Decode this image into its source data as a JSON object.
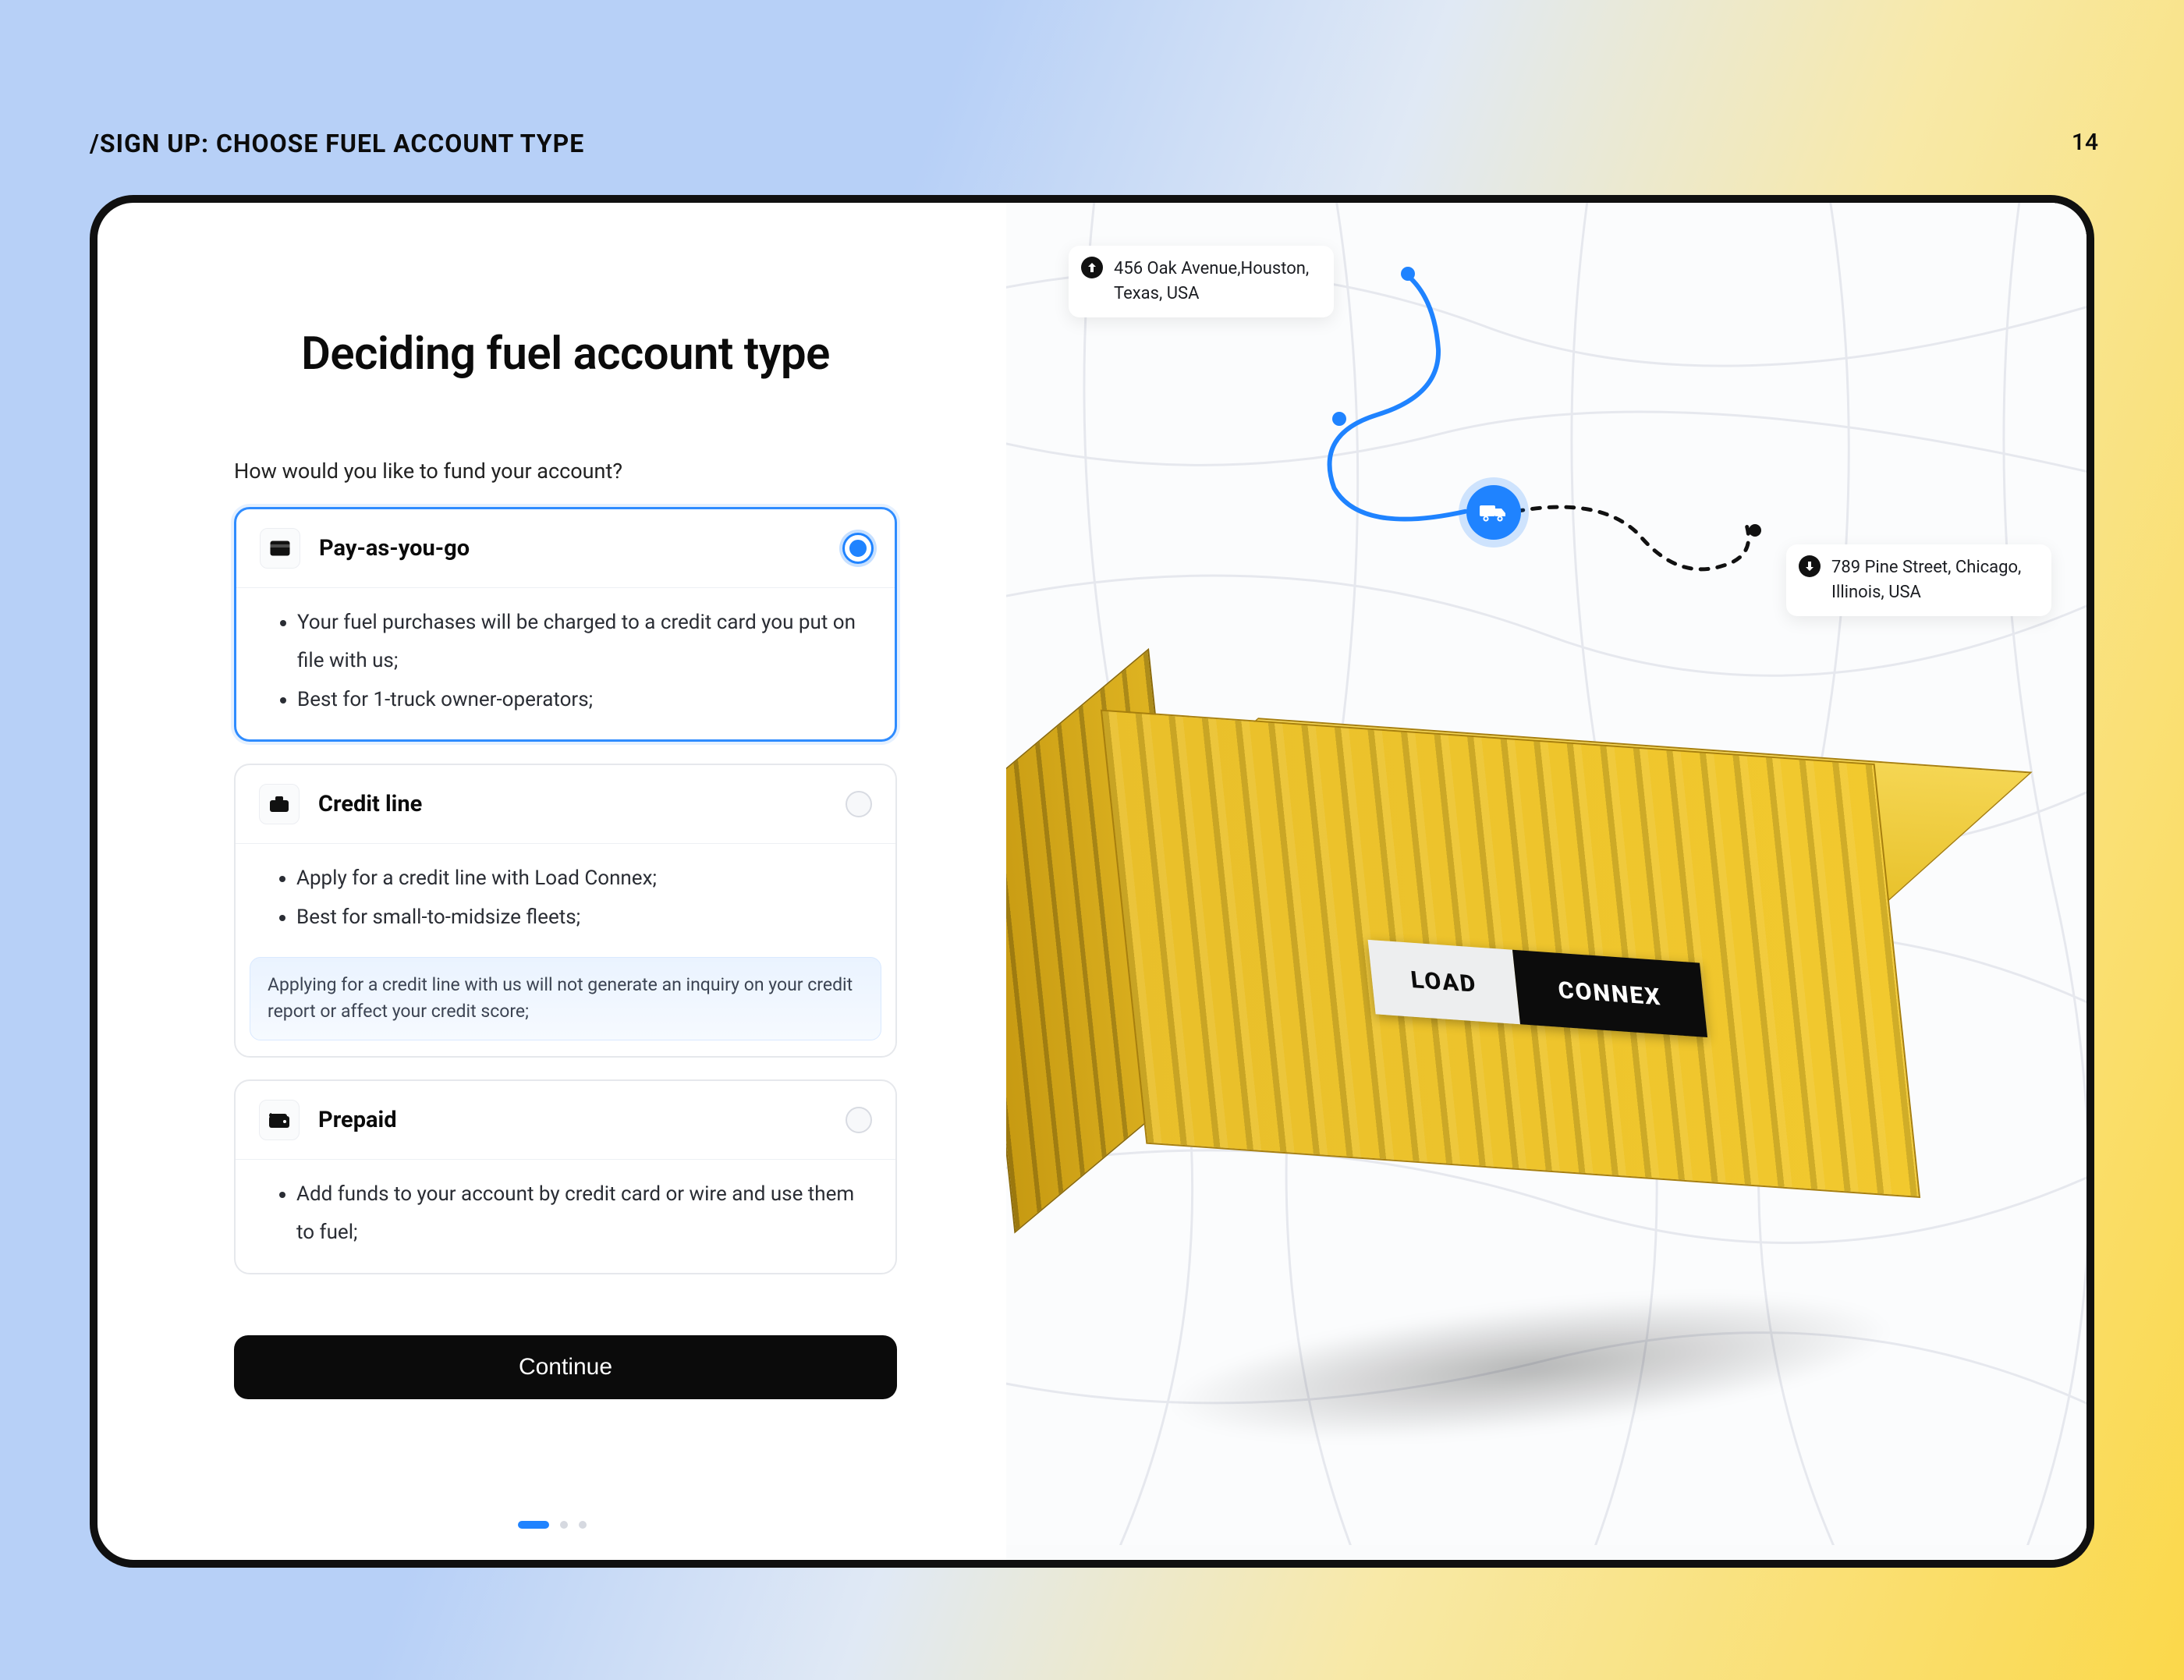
{
  "slide": {
    "title": "/SIGN UP: CHOOSE FUEL ACCOUNT TYPE",
    "number": "14"
  },
  "form": {
    "heading": "Deciding fuel account type",
    "question": "How would you like to fund your account?",
    "options": [
      {
        "id": "pay-as-you-go",
        "title": "Pay-as-you-go",
        "selected": true,
        "icon": "credit-card-icon",
        "bullets": [
          "Your fuel purchases will be charged to a credit card you put on file with us;",
          "Best for 1-truck owner-operators;"
        ]
      },
      {
        "id": "credit-line",
        "title": "Credit line",
        "selected": false,
        "icon": "briefcase-icon",
        "bullets": [
          "Apply for a credit line with Load Connex;",
          "Best for small-to-midsize fleets;"
        ],
        "notice": "Applying for a credit line with us will not generate an inquiry on your credit report or affect your credit score;"
      },
      {
        "id": "prepaid",
        "title": "Prepaid",
        "selected": false,
        "icon": "wallet-icon",
        "bullets": [
          "Add funds to your account by credit card or wire and use them to fuel;"
        ]
      }
    ],
    "continue_label": "Continue",
    "pager": {
      "total": 3,
      "active_index": 0
    }
  },
  "map": {
    "origin": {
      "address": "456 Oak Avenue,Houston, Texas, USA"
    },
    "destination": {
      "address": "789 Pine Street, Chicago, Illinois, USA"
    },
    "vehicle_marker": "truck-icon"
  },
  "brand": {
    "logo_left": "LOAD",
    "logo_right": "CONNEX"
  },
  "colors": {
    "accent": "#1f83ff",
    "container": "#f2c92e",
    "ink": "#0b0b0b"
  }
}
